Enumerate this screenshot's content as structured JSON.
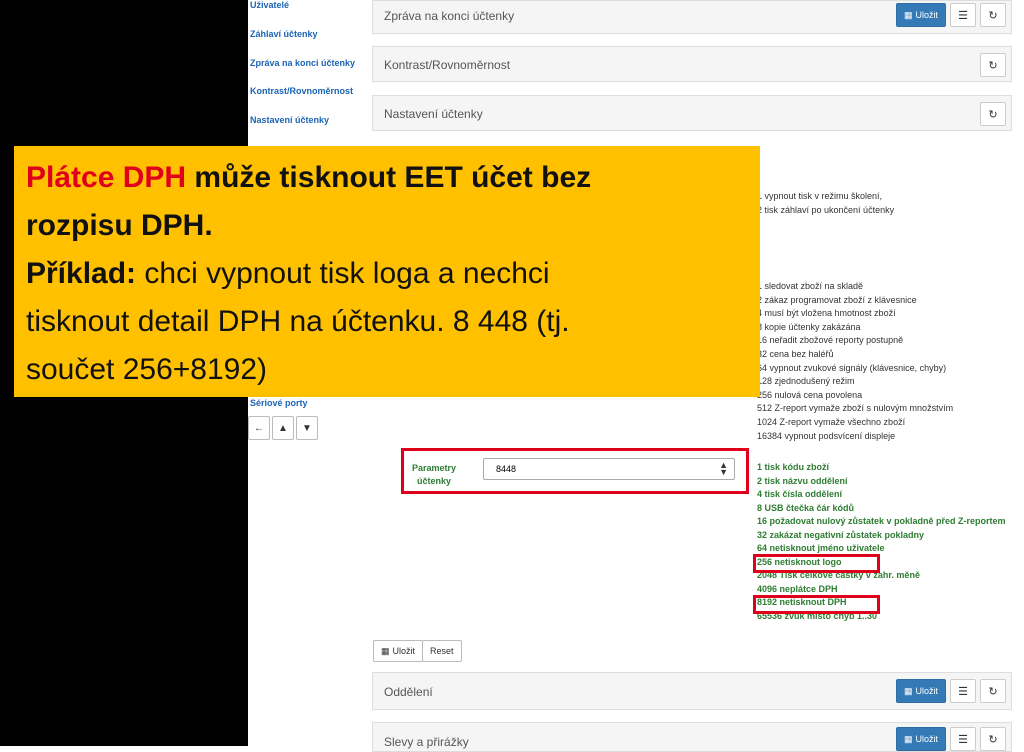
{
  "sidebar": {
    "items": [
      "Uživatelé",
      "Záhlaví účtenky",
      "Zpráva na konci účtenky",
      "Kontrast/Rovnoměrnost",
      "Nastavení účtenky",
      "Sériové porty"
    ]
  },
  "nav_icons": [
    "arrow-left-icon",
    "upload-icon",
    "download-icon"
  ],
  "panels": {
    "zprava": {
      "title": "Zpráva na konci účtenky"
    },
    "kontrast": {
      "title": "Kontrast/Rovnoměrnost"
    },
    "nastaveni": {
      "title": "Nastavení účtenky"
    },
    "oddeleni": {
      "title": "Oddělení"
    },
    "slevy": {
      "title": "Slevy a přirážky"
    }
  },
  "buttons": {
    "save": "Uložit",
    "reset": "Reset"
  },
  "top_list": [
    "1 vypnout tisk v režimu školení,",
    "2 tisk záhlaví po ukončení účtenky"
  ],
  "mid_list": [
    "1 sledovat zboží na skladě",
    "2 zákaz programovat zboží z klávesnice",
    "4 musí být vložena hmotnost zboží",
    "8 kopie účtenky zakázána",
    "16 neřadit zbožové reporty postupně",
    "32 cena bez haléřů",
    "64 vypnout zvukové signály (klávesnice, chyby)",
    "128 zjednodušený režim",
    "256 nulová cena povolena",
    "512 Z-report vymaže zboží s nulovým množstvím",
    "1024 Z-report vymaže všechno zboží",
    "16384 vypnout podsvícení displeje"
  ],
  "param": {
    "label_line1": "Parametry",
    "label_line2": "účtenky",
    "value": "8448"
  },
  "param_list": [
    "1 tisk kódu zboží",
    "2 tisk názvu oddělení",
    "4 tisk čísla oddělení",
    "8 USB čtečka čár kódů",
    "16 požadovat nulový zůstatek v pokladně před Z-reportem",
    "32 zakázat negativní zůstatek pokladny",
    "64 netisknout jméno uživatele",
    "256 netisknout logo",
    "2048 Tisk celkové částky v zahr. měně",
    "4096 neplátce DPH",
    "8192 netisknout DPH",
    "65536 zvuk místo chyb 1..30"
  ],
  "overlay": {
    "red_text": "Plátce DPH",
    "line1_rest": " může tisknout EET účet bez",
    "line2": "rozpisu DPH.",
    "example_label": "Příklad:",
    "line3_rest": " chci vypnout tisk loga a nechci",
    "line4": "tisknout detail DPH na účtenku. 8 448 (tj.",
    "line5": "součet 256+8192)"
  },
  "colors": {
    "accent": "#337ab7",
    "overlay": "#ffc000",
    "highlight": "#e0001b",
    "green": "#2e7d32"
  }
}
